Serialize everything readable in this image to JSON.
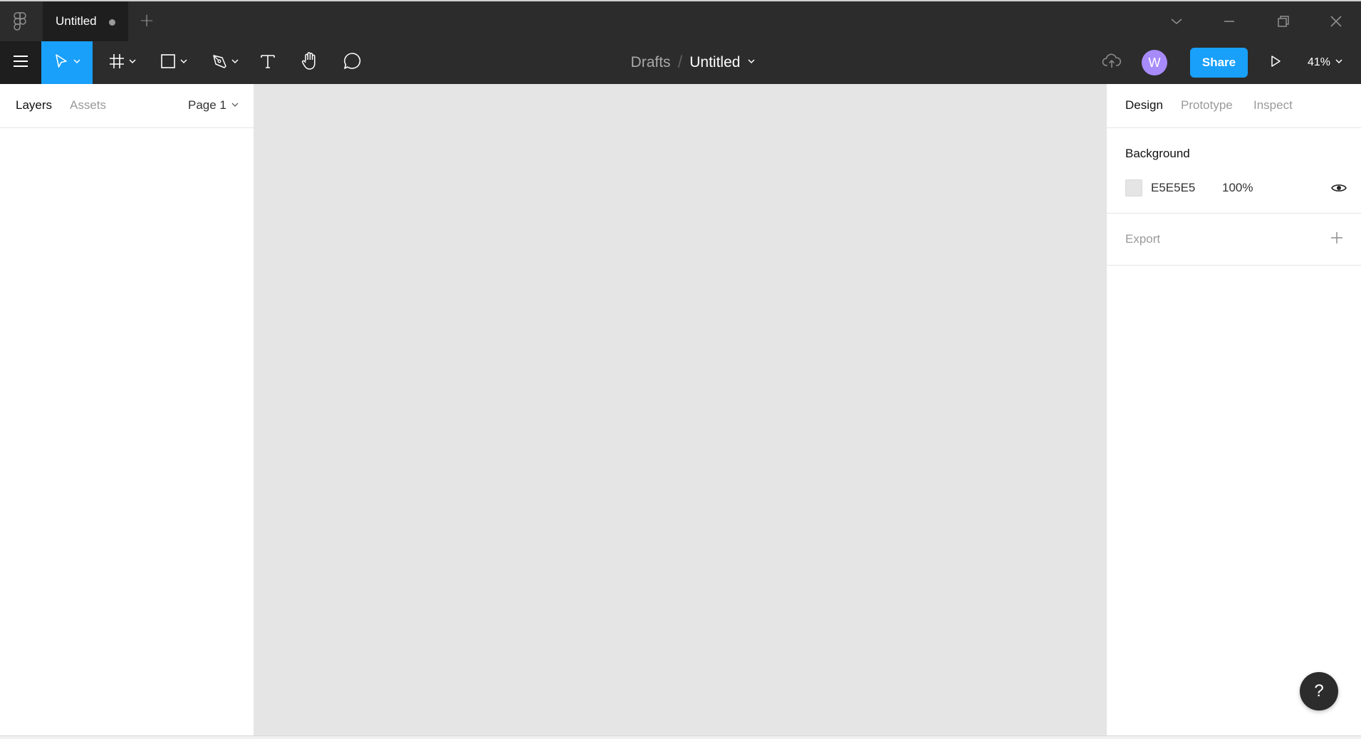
{
  "titlebar": {
    "tab_title": "Untitled",
    "logo_icon": "figma-logo-icon",
    "window_controls": [
      "chevron-down-icon",
      "minimize-icon",
      "restore-icon",
      "close-icon"
    ]
  },
  "toolbar": {
    "tools": [
      "main-menu-icon",
      "move-tool-icon",
      "frame-tool-icon",
      "shape-tool-icon",
      "pen-tool-icon",
      "text-tool-icon",
      "hand-tool-icon",
      "comment-tool-icon"
    ],
    "breadcrumb_parent": "Drafts",
    "breadcrumb_sep": "/",
    "file_name": "Untitled",
    "avatar_initial": "W",
    "share_label": "Share",
    "zoom": "41%"
  },
  "left_panel": {
    "tab_layers": "Layers",
    "tab_assets": "Assets",
    "page": "Page 1"
  },
  "right_panel": {
    "tab_design": "Design",
    "tab_prototype": "Prototype",
    "tab_inspect": "Inspect",
    "background_label": "Background",
    "background_hex": "E5E5E5",
    "background_opacity": "100%",
    "export_label": "Export"
  },
  "help": {
    "label": "?"
  },
  "colors": {
    "accent": "#18a0fb",
    "chrome": "#2c2c2c",
    "canvas": "#e5e5e5",
    "avatar": "#a78bfa"
  }
}
